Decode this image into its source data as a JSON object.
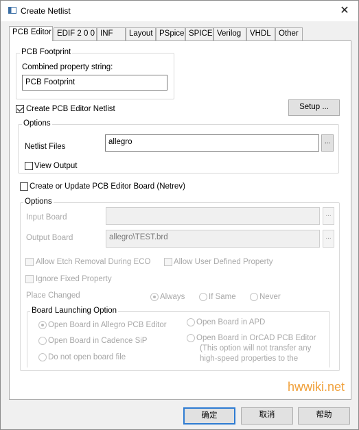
{
  "window": {
    "title": "Create Netlist",
    "close_glyph": "✕"
  },
  "tabs": [
    {
      "label": "PCB Editor"
    },
    {
      "label": "EDIF 2 0 0"
    },
    {
      "label": "INF"
    },
    {
      "label": "Layout"
    },
    {
      "label": "PSpice"
    },
    {
      "label": "SPICE"
    },
    {
      "label": "Verilog"
    },
    {
      "label": "VHDL"
    },
    {
      "label": "Other"
    }
  ],
  "pcb_footprint": {
    "group_title": "PCB Footprint",
    "combined_label": "Combined property string:",
    "combined_value": "PCB Footprint"
  },
  "create_netlist": {
    "label": "Create PCB Editor Netlist",
    "checked": true
  },
  "setup_button": "Setup ...",
  "netlist_options": {
    "group_title": "Options",
    "files_label": "Netlist Files",
    "files_value": "allegro",
    "browse": "...",
    "view_output": "View Output"
  },
  "create_board": {
    "label": "Create or Update PCB Editor Board (Netrev)",
    "checked": false
  },
  "board_options": {
    "group_title": "Options",
    "input_board_label": "Input Board",
    "input_board_value": "",
    "output_board_label": "Output Board",
    "output_board_value": "allegro\\TEST.brd",
    "browse": "...",
    "allow_etch": "Allow Etch Removal During ECO",
    "allow_user_prop": "Allow User Defined Property",
    "ignore_fixed": "Ignore Fixed Property",
    "place_changed_label": "Place Changed",
    "place_changed_options": [
      "Always",
      "If Same",
      "Never"
    ]
  },
  "board_launch": {
    "group_title": "Board Launching Option",
    "open_allegro": "Open Board in Allegro PCB Editor",
    "open_apd": "Open Board in APD",
    "open_sip": "Open Board in Cadence SiP",
    "open_orcad": "Open Board in OrCAD PCB Editor",
    "orcad_note_1": "(This option will not transfer any",
    "orcad_note_2": "high-speed properties to the",
    "no_open": "Do not open board file"
  },
  "watermark": "hwwiki.net",
  "footer": {
    "ok": "确定",
    "cancel": "取消",
    "help": "帮助"
  },
  "colors": {
    "accent": "#2d7bd2",
    "watermark": "#f0a03a",
    "disabled_text": "#a8a8a8"
  }
}
